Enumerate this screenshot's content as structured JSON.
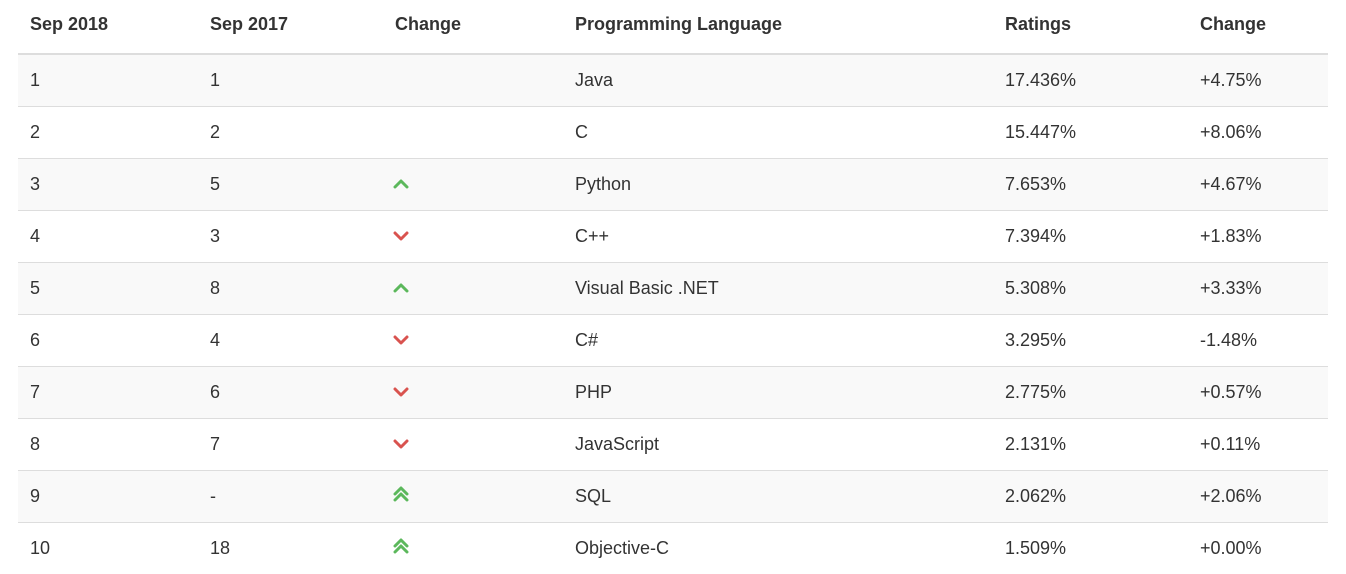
{
  "table": {
    "columns": [
      "Sep 2018",
      "Sep 2017",
      "Change",
      "Programming Language",
      "Ratings",
      "Change"
    ],
    "rows": [
      {
        "rank_2018": "1",
        "rank_2017": "1",
        "trend": "none",
        "language": "Java",
        "ratings": "17.436%",
        "delta": "+4.75%"
      },
      {
        "rank_2018": "2",
        "rank_2017": "2",
        "trend": "none",
        "language": "C",
        "ratings": "15.447%",
        "delta": "+8.06%"
      },
      {
        "rank_2018": "3",
        "rank_2017": "5",
        "trend": "up",
        "language": "Python",
        "ratings": "7.653%",
        "delta": "+4.67%"
      },
      {
        "rank_2018": "4",
        "rank_2017": "3",
        "trend": "down",
        "language": "C++",
        "ratings": "7.394%",
        "delta": "+1.83%"
      },
      {
        "rank_2018": "5",
        "rank_2017": "8",
        "trend": "up",
        "language": "Visual Basic .NET",
        "ratings": "5.308%",
        "delta": "+3.33%"
      },
      {
        "rank_2018": "6",
        "rank_2017": "4",
        "trend": "down",
        "language": "C#",
        "ratings": "3.295%",
        "delta": "-1.48%"
      },
      {
        "rank_2018": "7",
        "rank_2017": "6",
        "trend": "down",
        "language": "PHP",
        "ratings": "2.775%",
        "delta": "+0.57%"
      },
      {
        "rank_2018": "8",
        "rank_2017": "7",
        "trend": "down",
        "language": "JavaScript",
        "ratings": "2.131%",
        "delta": "+0.11%"
      },
      {
        "rank_2018": "9",
        "rank_2017": "-",
        "trend": "double-up",
        "language": "SQL",
        "ratings": "2.062%",
        "delta": "+2.06%"
      },
      {
        "rank_2018": "10",
        "rank_2017": "18",
        "trend": "double-up",
        "language": "Objective-C",
        "ratings": "1.509%",
        "delta": "+0.00%"
      }
    ]
  },
  "icons": {
    "up_color": "#5cb85c",
    "down_color": "#d9534f"
  }
}
